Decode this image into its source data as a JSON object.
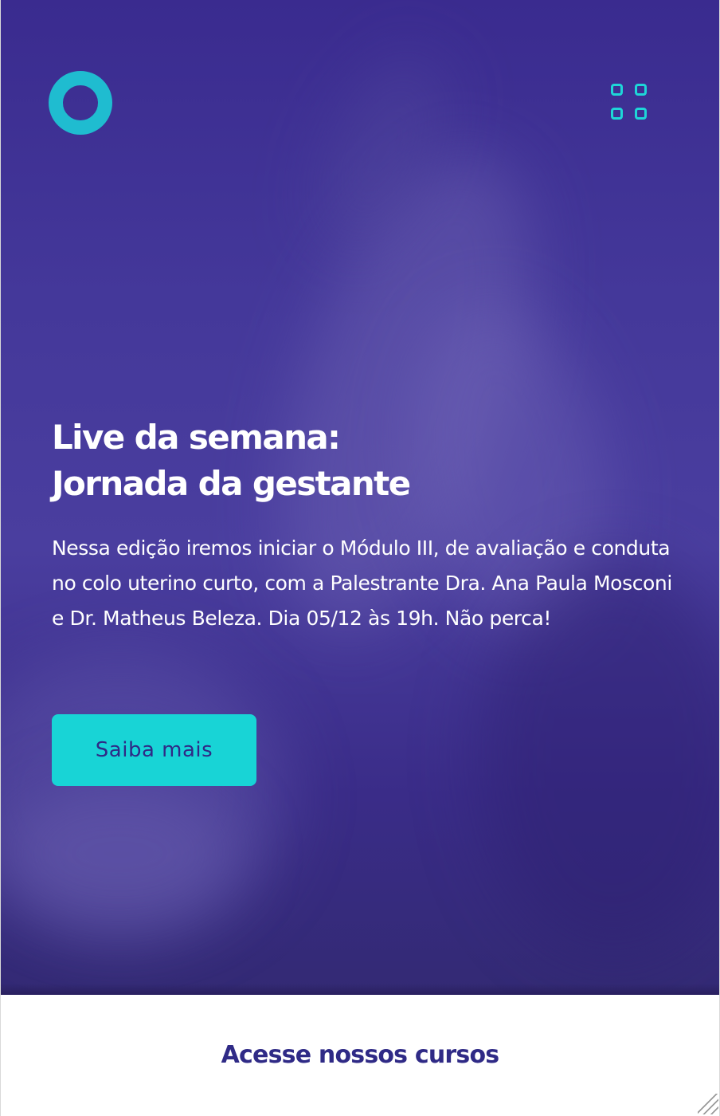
{
  "colors": {
    "hero_background": "#3e3193",
    "accent": "#1ed6d8",
    "logo": "#1fbcd0",
    "button_text": "#2f2a86",
    "section_title": "#2f2a86",
    "text_light": "#ffffff"
  },
  "header": {
    "logo_icon": "ring-logo-icon",
    "menu_icon": "grid-menu-icon"
  },
  "hero": {
    "title_line1": "Live da semana:",
    "title_line2": "Jornada da gestante",
    "description": "Nessa edição iremos iniciar o Módulo III, de avaliação e conduta no colo uterino curto, com a Palestrante Dra. Ana Paula Mosconi e Dr. Matheus Beleza. Dia 05/12 às 19h. Não perca!",
    "cta_label": "Saiba mais"
  },
  "courses": {
    "title": "Acesse nossos cursos"
  }
}
